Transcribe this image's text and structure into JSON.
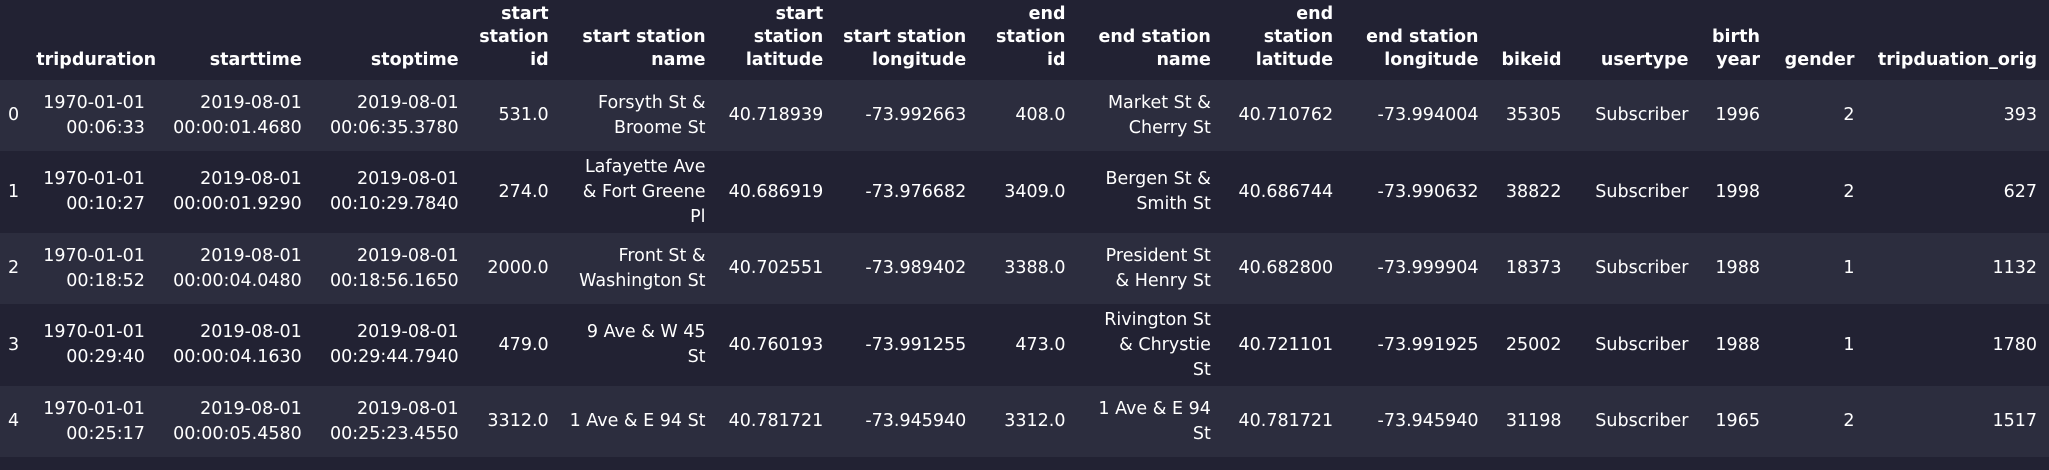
{
  "table": {
    "columns": [
      "",
      "tripduration",
      "starttime",
      "stoptime",
      "start\nstation\nid",
      "start station\nname",
      "start\nstation\nlatitude",
      "start station\nlongitude",
      "end\nstation\nid",
      "end station\nname",
      "end\nstation\nlatitude",
      "end station\nlongitude",
      "bikeid",
      "usertype",
      "birth\nyear",
      "gender",
      "tripduation_orig"
    ],
    "rows": [
      [
        "0",
        "1970-01-01\n00:06:33",
        "2019-08-01\n00:00:01.4680",
        "2019-08-01\n00:06:35.3780",
        "531.0",
        "Forsyth St &\nBroome St",
        "40.718939",
        "-73.992663",
        "408.0",
        "Market St &\nCherry St",
        "40.710762",
        "-73.994004",
        "35305",
        "Subscriber",
        "1996",
        "2",
        "393"
      ],
      [
        "1",
        "1970-01-01\n00:10:27",
        "2019-08-01\n00:00:01.9290",
        "2019-08-01\n00:10:29.7840",
        "274.0",
        "Lafayette Ave\n& Fort Greene\nPl",
        "40.686919",
        "-73.976682",
        "3409.0",
        "Bergen St &\nSmith St",
        "40.686744",
        "-73.990632",
        "38822",
        "Subscriber",
        "1998",
        "2",
        "627"
      ],
      [
        "2",
        "1970-01-01\n00:18:52",
        "2019-08-01\n00:00:04.0480",
        "2019-08-01\n00:18:56.1650",
        "2000.0",
        "Front St &\nWashington St",
        "40.702551",
        "-73.989402",
        "3388.0",
        "President St\n& Henry St",
        "40.682800",
        "-73.999904",
        "18373",
        "Subscriber",
        "1988",
        "1",
        "1132"
      ],
      [
        "3",
        "1970-01-01\n00:29:40",
        "2019-08-01\n00:00:04.1630",
        "2019-08-01\n00:29:44.7940",
        "479.0",
        "9 Ave & W 45\nSt",
        "40.760193",
        "-73.991255",
        "473.0",
        "Rivington St\n& Chrystie\nSt",
        "40.721101",
        "-73.991925",
        "25002",
        "Subscriber",
        "1988",
        "1",
        "1780"
      ],
      [
        "4",
        "1970-01-01\n00:25:17",
        "2019-08-01\n00:00:05.4580",
        "2019-08-01\n00:25:23.4550",
        "3312.0",
        "1 Ave & E 94 St",
        "40.781721",
        "-73.945940",
        "3312.0",
        "1 Ave & E 94\nSt",
        "40.781721",
        "-73.945940",
        "31198",
        "Subscriber",
        "1965",
        "2",
        "1517"
      ]
    ]
  }
}
